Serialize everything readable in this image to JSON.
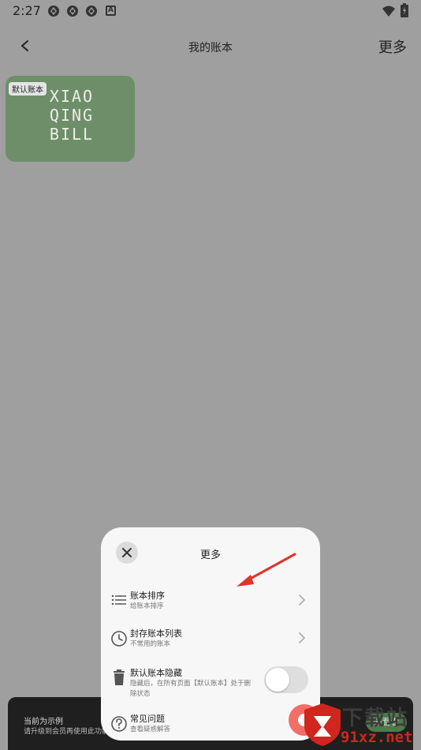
{
  "status_bar": {
    "time": "2:27",
    "icons": [
      "app-notification-icon",
      "app-notification-icon",
      "app-notification-icon",
      "a-badge-icon",
      "wifi-icon",
      "battery-icon"
    ],
    "a_badge": "A"
  },
  "app_bar": {
    "title": "我的账本",
    "more_label": "更多"
  },
  "book_card": {
    "badge": "默认账本",
    "logo_lines": [
      "XIAO",
      "QING",
      "BILL"
    ],
    "color": "#6e8e6a"
  },
  "promo": {
    "title": "当前为示例",
    "subtitle": "请升级到会员再使用此功能~",
    "button_label": "去看看"
  },
  "sheet": {
    "title": "更多",
    "items": [
      {
        "title": "账本排序",
        "subtitle": "给账本排序",
        "icon": "list-icon",
        "control": "chevron"
      },
      {
        "title": "封存账本列表",
        "subtitle": "不常用的账本",
        "icon": "clock-icon",
        "control": "chevron"
      },
      {
        "title": "默认账本隐藏",
        "subtitle": "隐藏后，在所有页面【默认账本】处于删除状态",
        "icon": "trash-icon",
        "control": "toggle",
        "toggle_on": false
      },
      {
        "title": "常见问题",
        "subtitle": "查看疑惑解答",
        "icon": "help-icon",
        "control": "none"
      }
    ]
  },
  "watermark": {
    "top": "下载站",
    "bottom": "91xz.net"
  },
  "colors": {
    "overlay": "#9f9f9f",
    "sheet_bg": "#f7f7f7",
    "accent_red": "#e0332c",
    "fab": "#f26f68"
  }
}
